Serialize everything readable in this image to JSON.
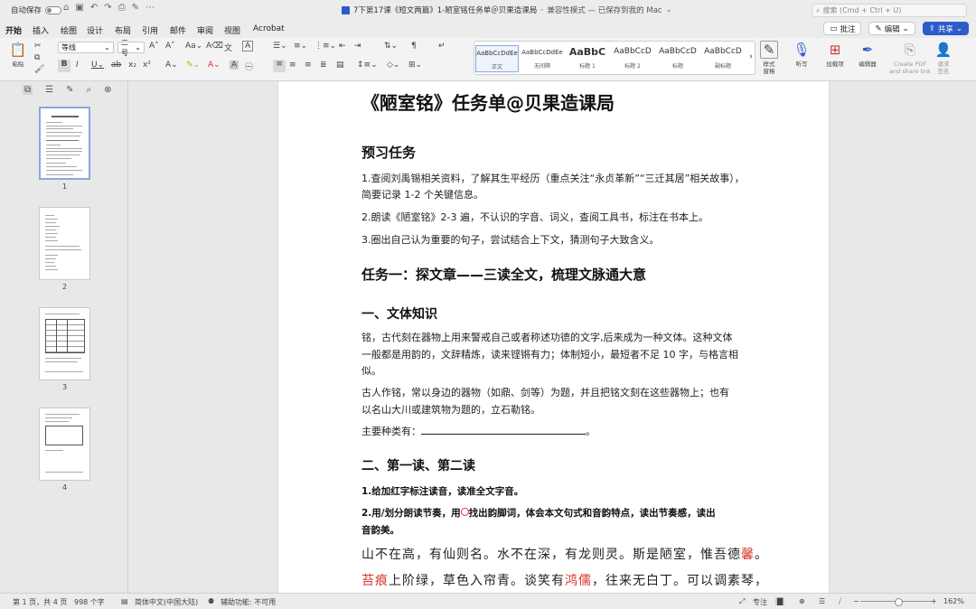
{
  "titlebar": {
    "autosave": "自动保存",
    "title": "7下第17课《短文两篇》1-陋室铭任务单＠贝果造课局",
    "mode": "兼容性模式 — 已保存到我的 Mac",
    "search_placeholder": "搜索 (Cmd + Ctrl + U)"
  },
  "tabs": [
    "开始",
    "插入",
    "绘图",
    "设计",
    "布局",
    "引用",
    "邮件",
    "审阅",
    "视图",
    "Acrobat"
  ],
  "buttons": {
    "comment": "批注",
    "edit": "编辑",
    "share": "共享"
  },
  "ribbon": {
    "paste": "粘贴",
    "font_name": "等线",
    "font_size": "二号",
    "styles": [
      {
        "preview": "AaBbCcDdEe",
        "name": "正文"
      },
      {
        "preview": "AaBbCcDdEe",
        "name": "无间隔"
      },
      {
        "preview": "AaBbC",
        "name": "标题 1"
      },
      {
        "preview": "AaBbCcD",
        "name": "标题 2"
      },
      {
        "preview": "AaBbCcD",
        "name": "标题"
      },
      {
        "preview": "AaBbCcD",
        "name": "副标题"
      }
    ],
    "style_pane": "样式\n窗格",
    "dictate": "听写",
    "addins": "加载项",
    "editor": "编辑器",
    "create_pdf": "Create PDF\nand share link",
    "signature": "请求\n签名"
  },
  "pages": [
    "1",
    "2",
    "3",
    "4"
  ],
  "doc": {
    "title": "《陋室铭》任务单@贝果造课局",
    "preview_heading": "预习任务",
    "pre1a": "1.查阅刘禹锡相关资料，了解其生平经历（重点关注“永贞革新”“三迁其居”相关故事），",
    "pre1b": "简要记录 1-2 个关键信息。",
    "pre2": "2.朗读《陋室铭》2-3 遍，不认识的字音、词义，查阅工具书，标注在书本上。",
    "pre3": "3.圈出自己认为重要的句子，尝试结合上下文，猜测句子大致含义。",
    "task1": "任务一：探文章——三读全文，梳理文脉通大意",
    "sec1": "一、文体知识",
    "ming1": "铭，古代刻在器物上用来警戒自己或者称述功德的文字,后来成为一种文体。这种文体",
    "ming2": "一般都是用韵的，文辞精炼，读来铿锵有力；体制短小，最短者不足 10 字，与格言相",
    "ming3": "似。",
    "anc1": "古人作铭，常以身边的器物（如鼎、剑等）为题，并且把铭文刻在这些器物上；也有",
    "anc2": "以名山大川或建筑物为题的，立石勒铭。",
    "types_label": "主要种类有：",
    "types_end": "。",
    "sec2": "二、第一读、第二读",
    "read1": "1.给加红字标注读音，读准全文字音。",
    "read2a": "2.用/划分朗读节奏，用",
    "read2b": "找出韵脚词，体会本文句式和音韵特点，读出节奏感，读出",
    "read2c": "音韵美。",
    "cl1a": "山不在高，有仙则名。水不在深，有龙则灵。斯是陋室，惟吾德",
    "cl1b": "馨",
    "cl1c": "。",
    "cl2a": "苔痕",
    "cl2b": "上阶绿，草色入帘青。谈笑有",
    "cl2c": "鸿儒",
    "cl2d": "，往来无白丁。可以调素琴，"
  },
  "status": {
    "page": "第 1 页，共 4 页",
    "words": "998 个字",
    "lang": "简体中文(中国大陆)",
    "access": "辅助功能: 不可用",
    "focus": "专注",
    "zoom": "162%"
  }
}
